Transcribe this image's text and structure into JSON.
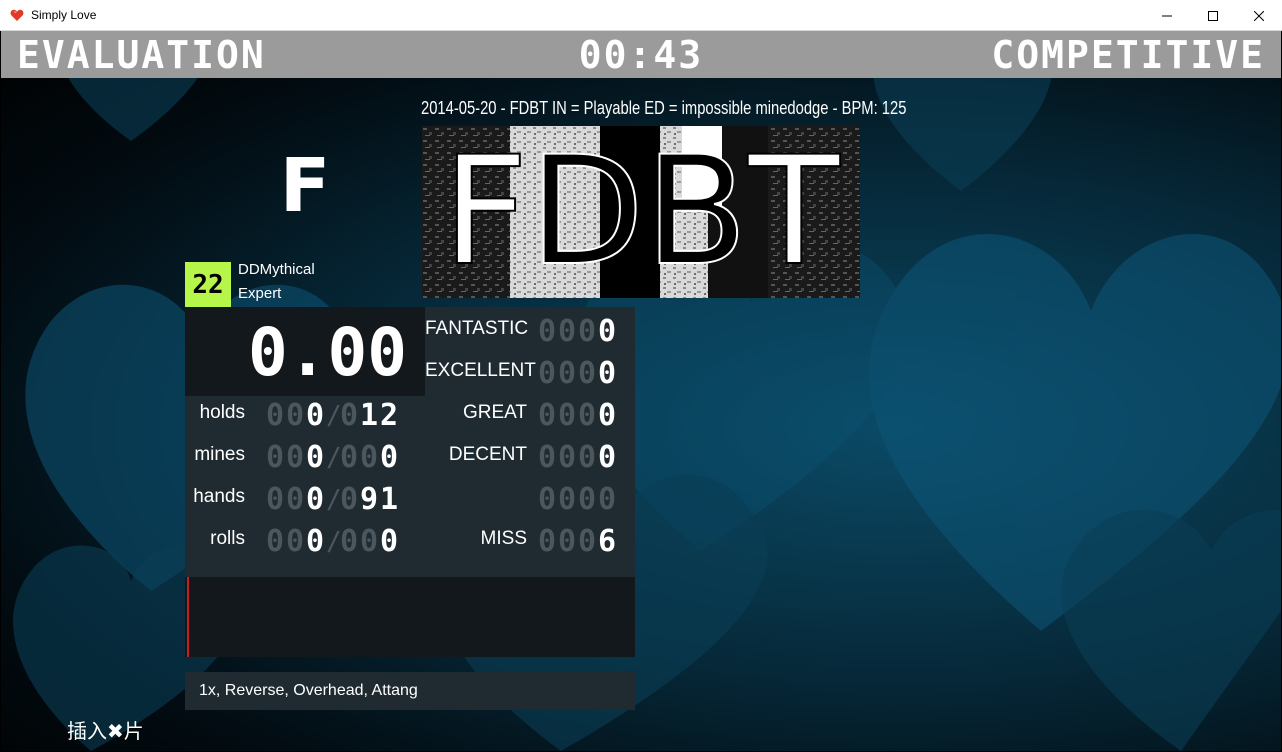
{
  "window": {
    "title": "Simply Love",
    "icon": "heart-icon",
    "controls": [
      "minimize-icon",
      "maximize-icon",
      "close-icon"
    ]
  },
  "header": {
    "left": "EVALUATION",
    "timer": "00:43",
    "right": "COMPETITIVE"
  },
  "song": {
    "info": "2014-05-20 - FDBT IN = Playable ED = impossible minedodge - BPM: 125",
    "banner_text": [
      "F",
      "D",
      "B",
      "T"
    ]
  },
  "grade": "F",
  "difficulty": {
    "meter": "22",
    "author": "DDMythical",
    "name": "Expert",
    "color": "#b6f54a"
  },
  "score": "0.00",
  "stats": [
    {
      "label": "holds",
      "value": "000",
      "total": "012"
    },
    {
      "label": "mines",
      "value": "000",
      "total": "000"
    },
    {
      "label": "hands",
      "value": "000",
      "total": "091"
    },
    {
      "label": "rolls",
      "value": "000",
      "total": "000"
    }
  ],
  "judgments": [
    {
      "label": "FANTASTIC",
      "count": "0000"
    },
    {
      "label": "EXCELLENT",
      "count": "0000"
    },
    {
      "label": "GREAT",
      "count": "0000"
    },
    {
      "label": "DECENT",
      "count": "0000"
    },
    {
      "label": "",
      "count": "0000"
    },
    {
      "label": "MISS",
      "count": "0006"
    }
  ],
  "modifiers": "1x, Reverse, Overhead, Attang",
  "bottom_text": "插入✖片"
}
